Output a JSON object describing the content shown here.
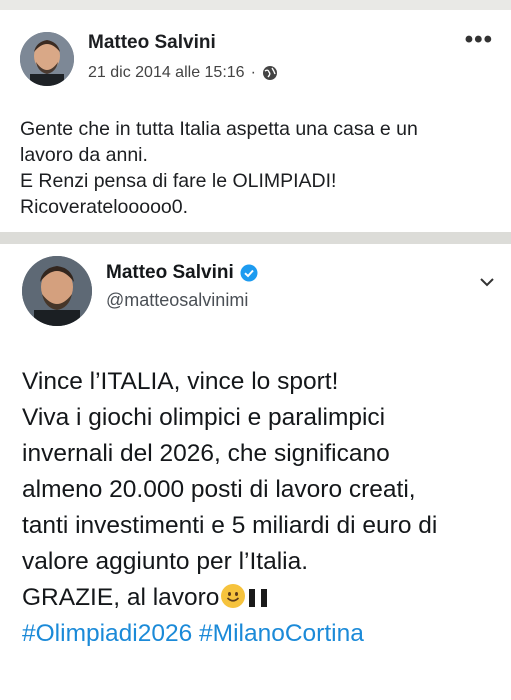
{
  "fb_post": {
    "author": "Matteo Salvini",
    "date": "21 dic 2014 alle 15:16",
    "separator": "·",
    "more_icon": "•••",
    "lines": [
      "Gente che in tutta Italia aspetta una casa e un",
      "lavoro da anni.",
      "E Renzi pensa di fare le OLIMPIADI!",
      "Ricoveratelooooo0."
    ]
  },
  "tweet": {
    "author": "Matteo Salvini",
    "handle": "@matteosalvinimi",
    "lines": [
      "Vince l’ITALIA, vince lo sport!",
      "Viva i giochi olimpici e paralimpici",
      "invernali del 2026, che significano",
      "almeno 20.000 posti di lavoro creati,",
      "tanti investimenti e 5 miliardi di euro di",
      "valore aggiunto per l’Italia."
    ],
    "last_line": "GRAZIE, al lavoro",
    "hashtags": "#Olimpiadi2026 #MilanoCortina"
  },
  "colors": {
    "hashtag": "#1b8ad8",
    "verified": "#1d9bf0"
  }
}
